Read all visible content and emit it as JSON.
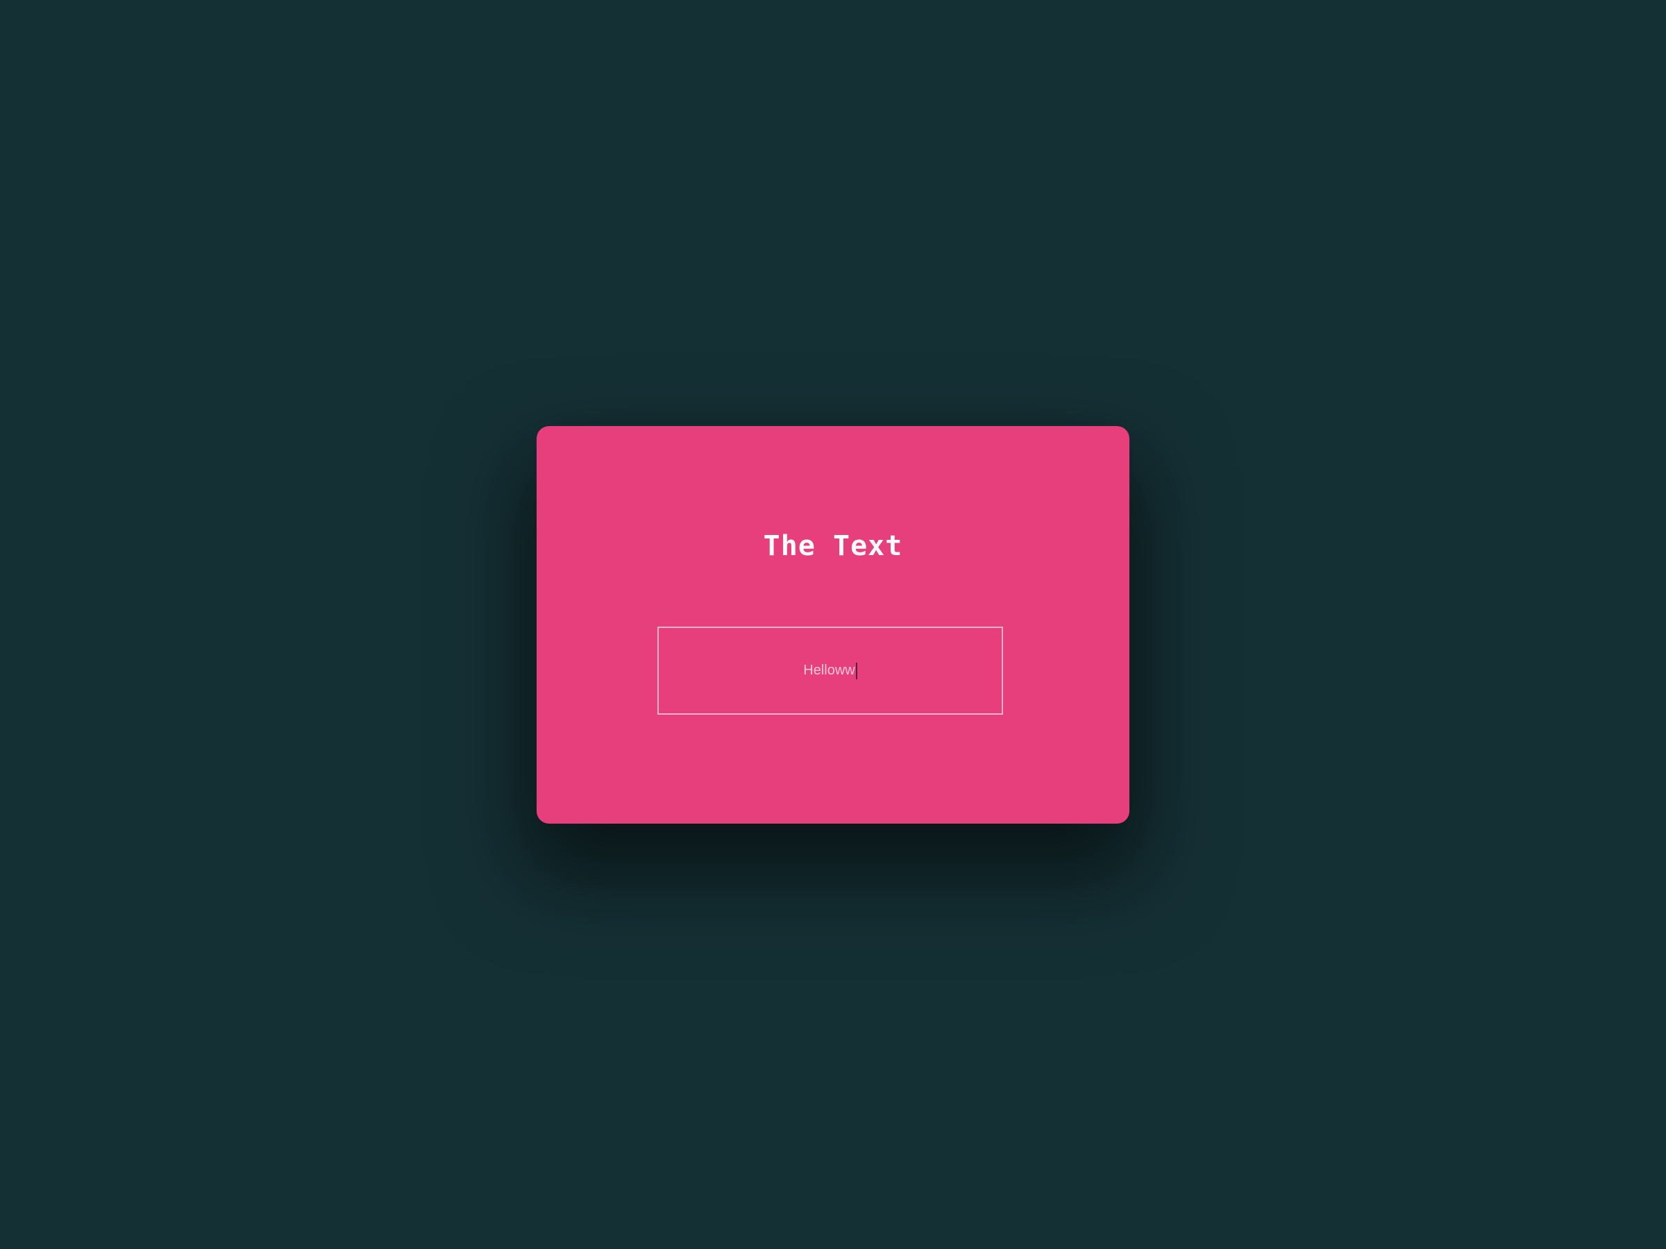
{
  "card": {
    "title": "The Text",
    "input": {
      "value": "Helloww"
    }
  },
  "colors": {
    "background": "#153035",
    "card": "#e63f7b",
    "input_border": "#f6b3cb"
  }
}
